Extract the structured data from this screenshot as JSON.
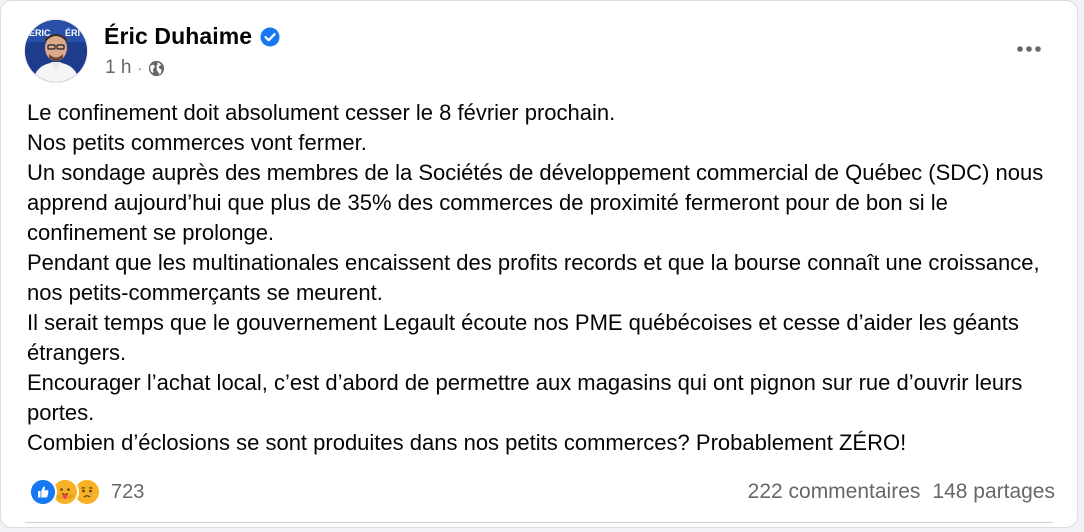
{
  "post": {
    "author": "Éric Duhaime",
    "time": "1 h",
    "separator": "·",
    "verified_icon": "verified-badge-icon",
    "audience_icon": "globe-icon",
    "more_label": "•••",
    "paragraphs": [
      "Le confinement doit absolument cesser le 8 février prochain.",
      "Nos petits commerces vont fermer.",
      "Un sondage auprès des membres de la Sociétés de développement commercial de Québec (SDC) nous apprend aujourd’hui que plus de 35% des commerces de proximité fermeront pour de bon si le confinement se prolonge.",
      "Pendant que les multinationales encaissent des profits records et que la bourse connaît une croissance, nos petits-commerçants se meurent.",
      "Il serait temps que le gouvernement Legault écoute nos PME québécoises et cesse d’aider les géants étrangers.",
      "Encourager l’achat local, c’est d’abord de permettre aux magasins qui ont pignon sur rue d’ouvrir leurs portes.",
      "Combien d’éclosions se sont produites dans nos petits commerces? Probablement ZÉRO!"
    ]
  },
  "reactions": {
    "types": [
      "like",
      "care",
      "sad"
    ],
    "count": "723"
  },
  "stats": {
    "comments": "222 commentaires",
    "shares": "148 partages"
  },
  "colors": {
    "facebook_blue": "#1877f2",
    "text_primary": "#050505",
    "text_secondary": "#65676b"
  }
}
